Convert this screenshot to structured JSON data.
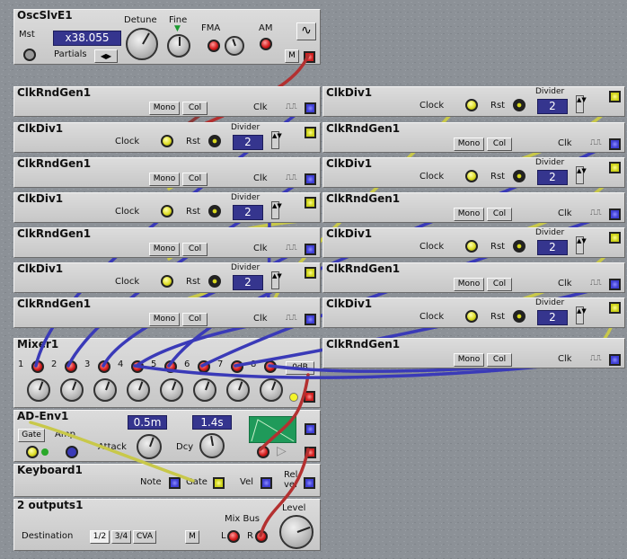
{
  "osc": {
    "title": "OscSlvE1",
    "mst": "Mst",
    "value": "x38.055",
    "partials": "Partials",
    "detune": "Detune",
    "fine": "Fine",
    "fma": "FMA",
    "am": "AM",
    "m_btn": "M",
    "wave_icon": "sine-wave-icon"
  },
  "labels": {
    "clkrnd": "ClkRndGen1",
    "clkdiv": "ClkDiv1",
    "mono": "Mono",
    "col": "Col",
    "clk": "Clk",
    "clock": "Clock",
    "rst": "Rst",
    "divider": "Divider",
    "divider_value": "2"
  },
  "mixer": {
    "title": "Mixer1",
    "inputs": [
      "1",
      "2",
      "3",
      "4",
      "5",
      "6",
      "7",
      "8"
    ],
    "db_btn": "0dB"
  },
  "adenv": {
    "title": "AD-Env1",
    "gate": "Gate",
    "amp": "Amp",
    "attack": "Attack",
    "attack_value": "0.5m",
    "decay": "Dcy",
    "decay_value": "1.4s",
    "scope_color": "#1f9a5a"
  },
  "keyboard": {
    "title": "Keyboard1",
    "note": "Note",
    "gate": "Gate",
    "vel": "Vel",
    "relvel_top": "Rel",
    "relvel_bottom": "vel"
  },
  "outputs": {
    "title": "2 outputs1",
    "destination": "Destination",
    "dest_opts": [
      "1/2",
      "3/4",
      "CVA"
    ],
    "m_btn": "M",
    "mixbus": "Mix Bus",
    "level": "Level",
    "l": "L",
    "r": "R"
  },
  "colors": {
    "cable_red": "#b33030",
    "cable_blue": "#3a3ab8",
    "cable_yellow": "#c8c84a",
    "background": "#8a9096"
  }
}
